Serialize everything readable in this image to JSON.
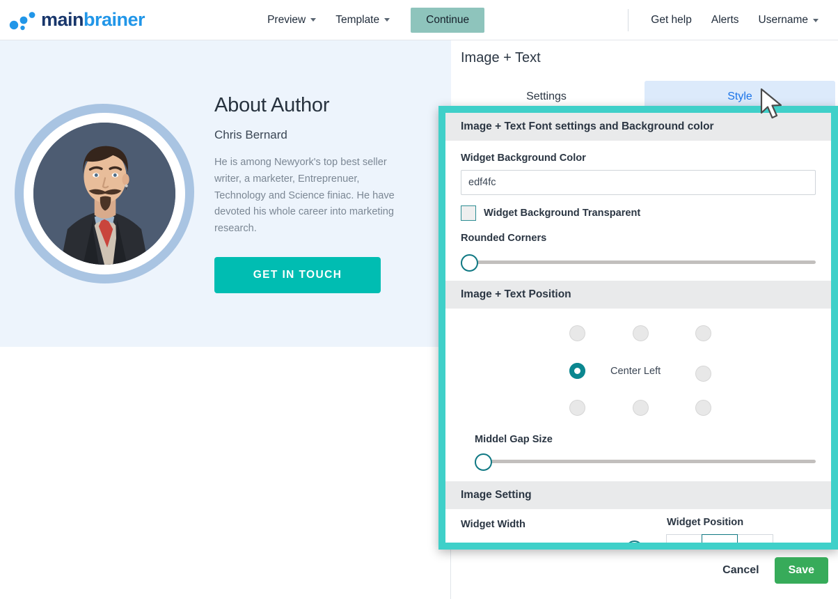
{
  "brand": {
    "name_part1": "main",
    "name_part2": "brainer",
    "accent": "#2196e8",
    "dark": "#18366b"
  },
  "topnav": {
    "preview": "Preview",
    "template": "Template",
    "continue": "Continue",
    "get_help": "Get help",
    "alerts": "Alerts",
    "username": "Username"
  },
  "widget": {
    "title": "About Author",
    "name": "Chris Bernard",
    "body": "He is among Newyork's top best seller writer, a marketer, Entreprenuer, Technology and Science finiac. He have devoted his whole career into marketing research.",
    "cta": "GET IN TOUCH",
    "background": "#edf4fc"
  },
  "panel": {
    "title": "Image + Text",
    "tabs": [
      {
        "label": "Settings",
        "active": false
      },
      {
        "label": "Style",
        "active": true
      }
    ]
  },
  "style_sections": {
    "font_bg": {
      "heading": "Image + Text Font settings and Background color",
      "bg_color_label": "Widget Background Color",
      "bg_color_value": "edf4fc",
      "bg_color_placeholder": "edf4fc",
      "transparent_label": "Widget Background Transparent",
      "transparent_checked": false,
      "rounded_label": "Rounded Corners",
      "rounded_value": 0
    },
    "position": {
      "heading": "Image + Text Position",
      "selected_label": "Center Left",
      "selected_index": 3,
      "gap_label": "Middel Gap Size",
      "gap_value": 2
    },
    "image_setting": {
      "heading": "Image Setting",
      "width_label": "Widget Width",
      "width_value": 96,
      "position_label": "Widget Position",
      "align_options": [
        "align-left",
        "align-center",
        "align-right"
      ],
      "align_selected": 1
    }
  },
  "footer": {
    "cancel": "Cancel",
    "save": "Save"
  },
  "colors": {
    "teal": "#00bdb2",
    "highlight": "#3fd0c9",
    "save_green": "#37ab5a",
    "tab_blue": "#1a73e8"
  }
}
